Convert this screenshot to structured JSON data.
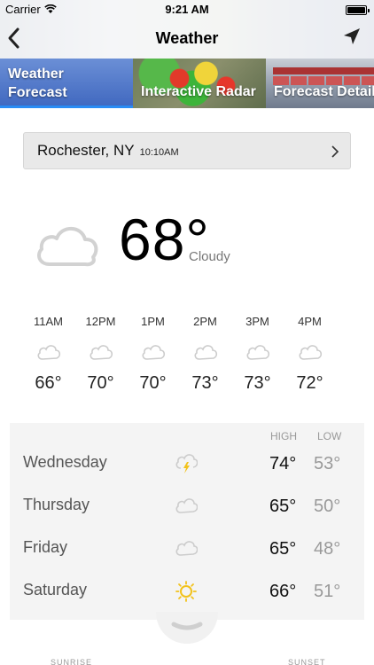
{
  "status_bar": {
    "carrier": "Carrier",
    "time": "9:21 AM",
    "battery_percent": 100
  },
  "header": {
    "title": "Weather",
    "back_icon": "chevron-left-icon",
    "location_icon": "location-arrow-icon"
  },
  "tabs": [
    {
      "label_line1": "Weather",
      "label_line2": "Forecast",
      "selected": true
    },
    {
      "label": "Interactive Radar",
      "selected": false
    },
    {
      "label": "Forecast Detail",
      "selected": false
    }
  ],
  "location": {
    "city": "Rochester, NY",
    "time": "10:10AM"
  },
  "current": {
    "temp": "68°",
    "condition": "Cloudy",
    "icon": "cloud-icon"
  },
  "hourly": [
    {
      "time": "11AM",
      "temp": "66°",
      "icon": "cloud-icon"
    },
    {
      "time": "12PM",
      "temp": "70°",
      "icon": "cloud-icon"
    },
    {
      "time": "1PM",
      "temp": "70°",
      "icon": "cloud-icon"
    },
    {
      "time": "2PM",
      "temp": "73°",
      "icon": "cloud-icon"
    },
    {
      "time": "3PM",
      "temp": "73°",
      "icon": "cloud-icon"
    },
    {
      "time": "4PM",
      "temp": "72°",
      "icon": "cloud-icon"
    }
  ],
  "daily": {
    "high_label": "HIGH",
    "low_label": "LOW",
    "days": [
      {
        "name": "Wednesday",
        "high": "74°",
        "low": "53°",
        "icon": "thunderstorm-icon"
      },
      {
        "name": "Thursday",
        "high": "65°",
        "low": "50°",
        "icon": "cloud-icon"
      },
      {
        "name": "Friday",
        "high": "65°",
        "low": "48°",
        "icon": "cloud-icon"
      },
      {
        "name": "Saturday",
        "high": "66°",
        "low": "51°",
        "icon": "sun-icon"
      }
    ]
  },
  "footer": {
    "sunrise_label": "SUNRISE",
    "sunset_label": "SUNSET"
  },
  "colors": {
    "accent": "#2a8cf4",
    "sun": "#f2c21b",
    "cloud_stroke": "#cccccc"
  }
}
